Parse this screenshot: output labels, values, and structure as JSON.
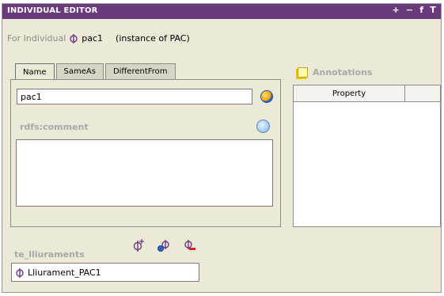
{
  "window": {
    "title": "INDIVIDUAL EDITOR",
    "controls": [
      "+",
      "−",
      "f",
      "T"
    ]
  },
  "individual": {
    "label": "For Individual",
    "name": "pac1",
    "instance_of": "(instance of PAC)"
  },
  "tabs": [
    {
      "label": "Name",
      "active": true
    },
    {
      "label": "SameAs",
      "active": false
    },
    {
      "label": "DifferentFrom",
      "active": false
    }
  ],
  "name_field": {
    "value": "pac1"
  },
  "comment": {
    "label": "rdfs:comment",
    "value": ""
  },
  "annotations": {
    "label": "Annotations",
    "columns": [
      "Property",
      ""
    ]
  },
  "links": {
    "label": "te_lliuraments",
    "items": [
      "Lliurament_PAC1"
    ]
  },
  "colors": {
    "titlebar": "#6b3a7a",
    "panel": "#ece9d8"
  },
  "icons": {
    "individual": "individual-icon",
    "globe": "globe-icon",
    "comment": "comment-bubble-icon",
    "annotation": "note-icon",
    "create": "create-individual-icon",
    "add": "add-individual-icon",
    "remove": "remove-individual-icon"
  }
}
